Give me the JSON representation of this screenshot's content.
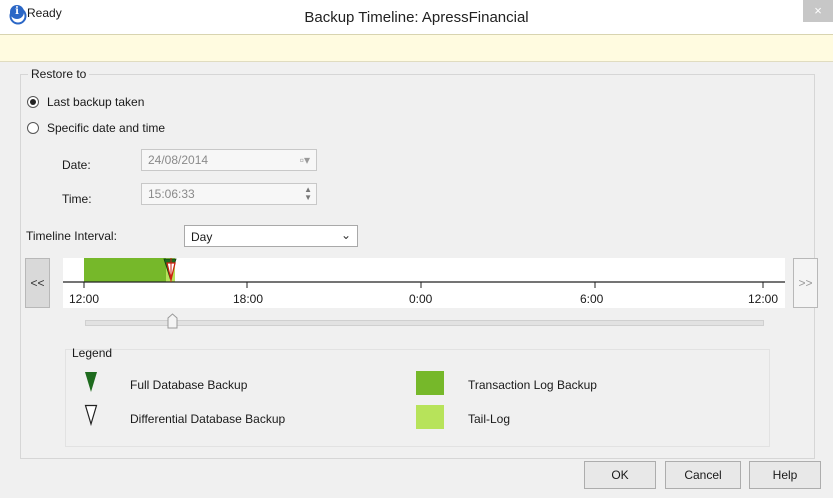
{
  "window": {
    "title": "Backup Timeline: ApressFinancial",
    "close_glyph": "×"
  },
  "status": {
    "icon": "info-icon",
    "icon_glyph": "i",
    "text": "Ready"
  },
  "restore": {
    "group_label": "Restore to",
    "option_last": "Last backup taken",
    "option_specific": "Specific date and time",
    "selected": "last",
    "date_label": "Date:",
    "date_value": "24/08/2014",
    "time_label": "Time:",
    "time_value": "15:06:33"
  },
  "timeline": {
    "interval_label": "Timeline Interval:",
    "interval_value": "Day",
    "prev_label": "<<",
    "next_label": ">>",
    "ticks": [
      "12:00",
      "18:00",
      "0:00",
      "6:00",
      "12:00"
    ],
    "colors": {
      "transaction_log": "#76b82a",
      "tail_log": "#b7e35a",
      "full_backup": "#1e6b1e",
      "track": "#222222"
    }
  },
  "legend": {
    "title": "Legend",
    "full_backup": "Full Database Backup",
    "differential_backup": "Differential Database Backup",
    "transaction_log": "Transaction Log Backup",
    "tail_log": "Tail-Log"
  },
  "buttons": {
    "ok": "OK",
    "cancel": "Cancel",
    "help": "Help"
  }
}
